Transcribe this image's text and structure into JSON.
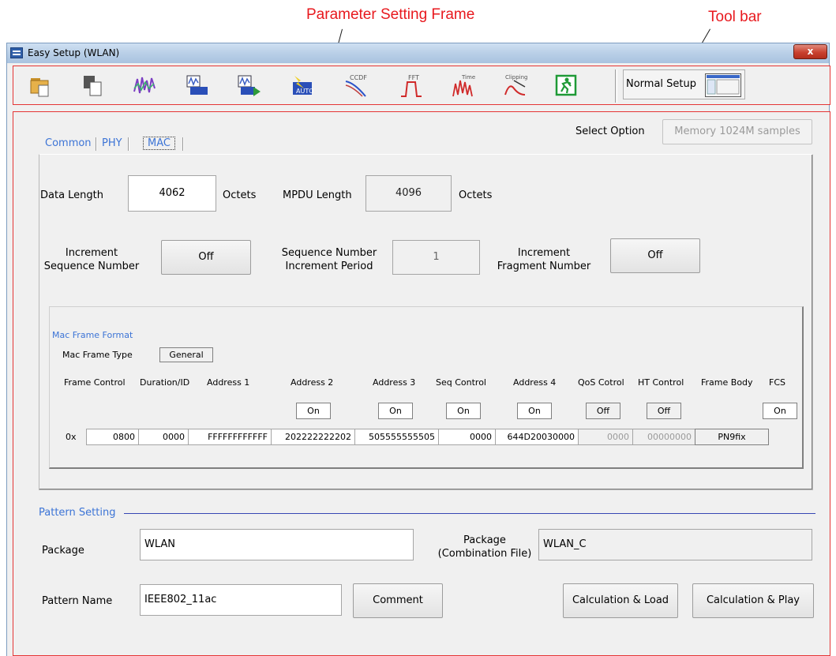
{
  "callouts": {
    "param_frame": "Parameter Setting Frame",
    "toolbar": "Tool bar"
  },
  "window": {
    "title": "Easy Setup (WLAN)",
    "close_glyph": "x"
  },
  "toolbar": {
    "buttons": [
      {
        "name": "open-folder-icon",
        "color": "#e0a838"
      },
      {
        "name": "copy-icon",
        "color": "#4a4a4a"
      },
      {
        "name": "waveform-icon",
        "color": "#7b3ec2"
      },
      {
        "name": "load-waveform-icon",
        "color": "#3b5fc4"
      },
      {
        "name": "load-play-icon",
        "color": "#2e9a3a"
      },
      {
        "name": "auto-setup-icon",
        "color": "#e8c620"
      },
      {
        "name": "ccdf-icon",
        "label": "CCDF",
        "color": "#2b53c9"
      },
      {
        "name": "fft-icon",
        "label": "FFT",
        "color": "#d02a2a"
      },
      {
        "name": "time-domain-icon",
        "label": "Time Domain",
        "color": "#d02a2a"
      },
      {
        "name": "clipping-icon",
        "label": "Clipping",
        "color": "#d02a2a"
      },
      {
        "name": "exit-icon",
        "color": "#1f9a36"
      }
    ],
    "normal_setup": "Normal Setup"
  },
  "select_option": {
    "label": "Select Option",
    "value": "Memory 1024M samples"
  },
  "tabs": [
    "Common",
    "PHY",
    "MAC"
  ],
  "active_tab": "MAC",
  "mac": {
    "data_length_label": "Data Length",
    "data_length": "4062",
    "octets": "Octets",
    "mpdu_length_label": "MPDU Length",
    "mpdu_length": "4096",
    "inc_seq_label_1": "Increment",
    "inc_seq_label_2": "Sequence Number",
    "inc_seq_value": "Off",
    "seq_period_label_1": "Sequence Number",
    "seq_period_label_2": "Increment Period",
    "seq_period_value": "1",
    "inc_frag_label_1": "Increment",
    "inc_frag_label_2": "Fragment Number",
    "inc_frag_value": "Off"
  },
  "mac_frame": {
    "format_label": "Mac Frame Format",
    "type_label": "Mac Frame Type",
    "type_value": "General",
    "prefix": "0x",
    "columns": [
      {
        "label": "Frame Control",
        "value": "0800"
      },
      {
        "label": "Duration/ID",
        "value": "0000"
      },
      {
        "label": "Address 1",
        "value": "FFFFFFFFFFFF"
      },
      {
        "label": "Address 2",
        "toggle": "On",
        "value": "202222222202"
      },
      {
        "label": "Address 3",
        "toggle": "On",
        "value": "505555555505"
      },
      {
        "label": "Seq Control",
        "toggle": "On",
        "value": "0000"
      },
      {
        "label": "Address 4",
        "toggle": "On",
        "value": "644D20030000"
      },
      {
        "label": "QoS Cotrol",
        "toggle": "Off",
        "value": "0000"
      },
      {
        "label": "HT Control",
        "toggle": "Off",
        "value": "00000000"
      },
      {
        "label": "Frame Body",
        "value": "PN9fix"
      },
      {
        "label": "FCS",
        "toggle": "On"
      }
    ]
  },
  "pattern": {
    "section_label": "Pattern Setting",
    "package_label": "Package",
    "package_value": "WLAN",
    "combo_label_1": "Package",
    "combo_label_2": "(Combination File)",
    "combo_value": "WLAN_C",
    "pattern_name_label": "Pattern Name",
    "pattern_name_value": "IEEE802_11ac",
    "comment_button": "Comment",
    "calc_load_button": "Calculation & Load",
    "calc_play_button": "Calculation & Play"
  }
}
